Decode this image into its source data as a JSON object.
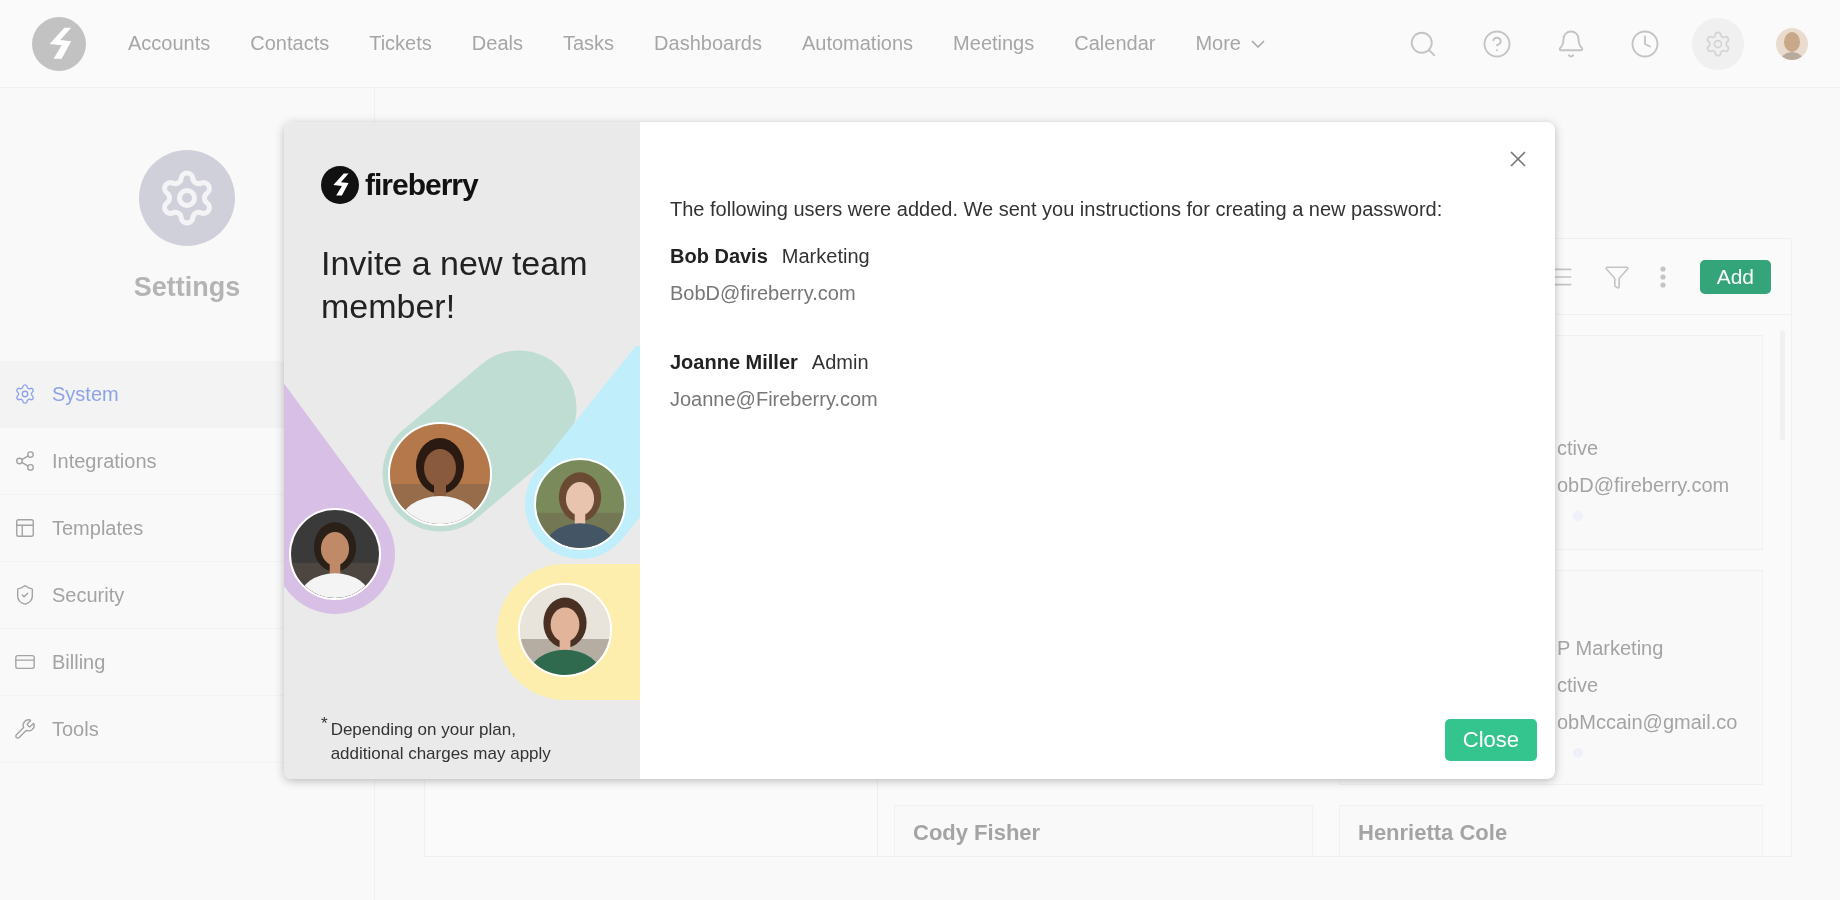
{
  "nav": {
    "items": [
      "Accounts",
      "Contacts",
      "Tickets",
      "Deals",
      "Tasks",
      "Dashboards",
      "Automations",
      "Meetings",
      "Calendar"
    ],
    "more": "More"
  },
  "sidebar": {
    "title": "Settings",
    "items": [
      {
        "label": "System",
        "kind": "gear",
        "selected": true
      },
      {
        "label": "Integrations",
        "kind": "share",
        "selected": false
      },
      {
        "label": "Templates",
        "kind": "layout",
        "selected": false
      },
      {
        "label": "Security",
        "kind": "shield",
        "selected": false
      },
      {
        "label": "Billing",
        "kind": "card",
        "selected": false
      },
      {
        "label": "Tools",
        "kind": "tools",
        "selected": false
      }
    ]
  },
  "panel": {
    "add_button": "Add",
    "right_column": [
      {
        "lines": [
          "ctive",
          "obD@fireberry.com"
        ]
      },
      {
        "lines": [
          "P Marketing",
          "ctive",
          "obMccain@gmail.co"
        ]
      },
      {
        "name": "Henrietta Cole"
      }
    ],
    "middle_column": [
      {
        "name": "Cody Fisher"
      }
    ]
  },
  "modal": {
    "brand": "fireberry",
    "heading": "Invite a new team member!",
    "footnote_mark": "*",
    "footnote": "Depending on your plan, additional charges may apply",
    "message": "The following users were added. We sent you instructions for creating a new password:",
    "users": [
      {
        "name": "Bob Davis",
        "role": "Marketing",
        "email": "BobD@fireberry.com"
      },
      {
        "name": "Joanne Miller",
        "role": "Admin",
        "email": "Joanne@Fireberry.com"
      }
    ],
    "close_button": "Close"
  }
}
